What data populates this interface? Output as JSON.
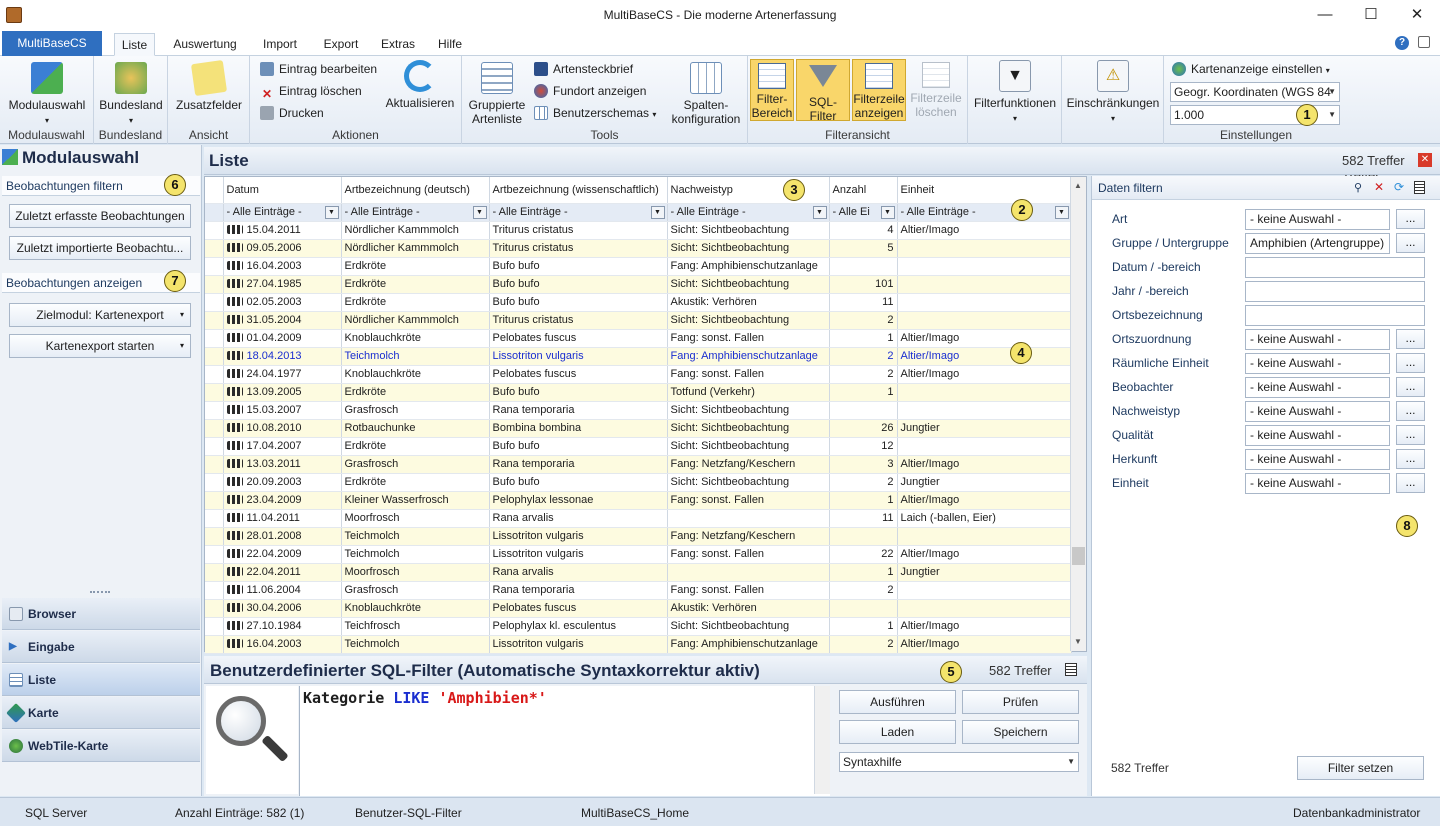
{
  "window": {
    "title": "MultiBaseCS - Die moderne Artenerfassung",
    "minimize": "—",
    "maximize": "☐",
    "close": "✕"
  },
  "ribbon_tabs": {
    "file": "MultiBaseCS",
    "tabs": [
      "Liste",
      "Auswertung",
      "Import",
      "Export",
      "Extras",
      "Hilfe"
    ],
    "help": "?"
  },
  "ribbon": {
    "modulauswahl": {
      "button": "Modulauswahl",
      "label": "Modulauswahl"
    },
    "bundesland": {
      "button": "Bundesland",
      "label": "Bundesland"
    },
    "ansicht": {
      "button": "Zusatzfelder",
      "label": "Ansicht"
    },
    "aktionen": {
      "edit": "Eintrag  bearbeiten",
      "delete": "Eintrag  löschen",
      "print": "Drucken",
      "refresh": "Aktualisieren",
      "label": "Aktionen"
    },
    "tools": {
      "grouped_line1": "Gruppierte",
      "grouped_line2": "Artenliste",
      "steckbrief": "Artensteckbrief",
      "fundort": "Fundort anzeigen",
      "schemas": "Benutzerschemas",
      "spalten_line1": "Spalten-",
      "spalten_line2": "konfiguration",
      "label": "Tools"
    },
    "filteransicht": {
      "bereich_line1": "Filter-",
      "bereich_line2": "Bereich",
      "sql": "SQL-Filter",
      "zeile_line1": "Filterzeile",
      "zeile_line2": "anzeigen",
      "loeschen_line1": "Filterzeile",
      "loeschen_line2": "löschen",
      "label": "Filteransicht"
    },
    "filterfunktionen": {
      "button": "Filterfunktionen"
    },
    "einschraenkungen": {
      "button": "Einschränkungen"
    },
    "einstellungen": {
      "karte": "Kartenanzeige  einstellen",
      "coords": "Geogr. Koordinaten (WGS 84",
      "scale": "1.000",
      "label": "Einstellungen"
    }
  },
  "callouts": [
    "1",
    "2",
    "3",
    "4",
    "5",
    "6",
    "7",
    "8"
  ],
  "left": {
    "title": "Modulauswahl",
    "section1": "Beobachtungen filtern",
    "btn1": "Zuletzt erfasste Beobachtungen",
    "btn2": "Zuletzt  importierte Beobachtu...",
    "section2": "Beobachtungen anzeigen",
    "btn3": "Zielmodul: Kartenexport",
    "btn4": "Kartenexport starten",
    "nav": [
      "Browser",
      "Eingabe",
      "Liste",
      "Karte",
      "WebTile-Karte"
    ]
  },
  "list": {
    "title": "Liste",
    "count": "582 Treffer",
    "columns": [
      "Datum",
      "Artbezeichnung (deutsch)",
      "Artbezeichnung (wissenschaftlich)",
      "Nachweistyp",
      "Anzahl",
      "Einheit"
    ],
    "filters": [
      "- Alle Einträge -",
      "- Alle Einträge -",
      "- Alle Einträge -",
      "- Alle Einträge -",
      "- Alle Ei",
      "- Alle Einträge -"
    ],
    "rows": [
      [
        "15.04.2011",
        "Nördlicher Kammmolch",
        "Triturus cristatus",
        "Sicht: Sichtbeobachtung",
        "4",
        "Altier/Imago"
      ],
      [
        "09.05.2006",
        "Nördlicher Kammmolch",
        "Triturus cristatus",
        "Sicht: Sichtbeobachtung",
        "5",
        ""
      ],
      [
        "16.04.2003",
        "Erdkröte",
        "Bufo bufo",
        "Fang: Amphibienschutzanlage",
        "",
        ""
      ],
      [
        "27.04.1985",
        "Erdkröte",
        "Bufo bufo",
        "Sicht: Sichtbeobachtung",
        "101",
        ""
      ],
      [
        "02.05.2003",
        "Erdkröte",
        "Bufo bufo",
        "Akustik: Verhören",
        "11",
        ""
      ],
      [
        "31.05.2004",
        "Nördlicher Kammmolch",
        "Triturus cristatus",
        "Sicht: Sichtbeobachtung",
        "2",
        ""
      ],
      [
        "01.04.2009",
        "Knoblauchkröte",
        "Pelobates fuscus",
        "Fang: sonst. Fallen",
        "1",
        "Altier/Imago"
      ],
      [
        "18.04.2013",
        "Teichmolch",
        "Lissotriton vulgaris",
        "Fang: Amphibienschutzanlage",
        "2",
        "Altier/Imago"
      ],
      [
        "24.04.1977",
        "Knoblauchkröte",
        "Pelobates fuscus",
        "Fang: sonst. Fallen",
        "2",
        "Altier/Imago"
      ],
      [
        "13.09.2005",
        "Erdkröte",
        "Bufo bufo",
        "Totfund (Verkehr)",
        "1",
        ""
      ],
      [
        "15.03.2007",
        "Grasfrosch",
        "Rana temporaria",
        "Sicht: Sichtbeobachtung",
        "",
        ""
      ],
      [
        "10.08.2010",
        "Rotbauchunke",
        "Bombina bombina",
        "Sicht: Sichtbeobachtung",
        "26",
        "Jungtier"
      ],
      [
        "17.04.2007",
        "Erdkröte",
        "Bufo bufo",
        "Sicht: Sichtbeobachtung",
        "12",
        ""
      ],
      [
        "13.03.2011",
        "Grasfrosch",
        "Rana temporaria",
        "Fang: Netzfang/Keschern",
        "3",
        "Altier/Imago"
      ],
      [
        "20.09.2003",
        "Erdkröte",
        "Bufo bufo",
        "Sicht: Sichtbeobachtung",
        "2",
        "Jungtier"
      ],
      [
        "23.04.2009",
        "Kleiner Wasserfrosch",
        "Pelophylax lessonae",
        "Fang: sonst. Fallen",
        "1",
        "Altier/Imago"
      ],
      [
        "11.04.2011",
        "Moorfrosch",
        "Rana arvalis",
        "",
        "11",
        "Laich (-ballen, Eier)"
      ],
      [
        "28.01.2008",
        "Teichmolch",
        "Lissotriton vulgaris",
        "Fang: Netzfang/Keschern",
        "",
        ""
      ],
      [
        "22.04.2009",
        "Teichmolch",
        "Lissotriton vulgaris",
        "Fang: sonst. Fallen",
        "22",
        "Altier/Imago"
      ],
      [
        "22.04.2011",
        "Moorfrosch",
        "Rana arvalis",
        "",
        "1",
        "Jungtier"
      ],
      [
        "11.06.2004",
        "Grasfrosch",
        "Rana temporaria",
        "Fang: sonst. Fallen",
        "2",
        ""
      ],
      [
        "30.04.2006",
        "Knoblauchkröte",
        "Pelobates fuscus",
        "Akustik: Verhören",
        "",
        ""
      ],
      [
        "27.10.1984",
        "Teichfrosch",
        "Pelophylax kl. esculentus",
        "Sicht: Sichtbeobachtung",
        "1",
        "Altier/Imago"
      ],
      [
        "16.04.2003",
        "Teichmolch",
        "Lissotriton vulgaris",
        "Fang: Amphibienschutzanlage",
        "2",
        "Altier/Imago"
      ]
    ]
  },
  "sql": {
    "title": "Benutzerdefinierter SQL-Filter (Automatische Syntaxkorrektur aktiv)",
    "count": "582 Treffer",
    "code_field": "Kategorie",
    "code_kw": "LIKE",
    "code_str": "'Amphibien*'",
    "btn_run": "Ausführen",
    "btn_check": "Prüfen",
    "btn_load": "Laden",
    "btn_save": "Speichern",
    "syntax": "Syntaxhilfe"
  },
  "right": {
    "title": "Daten filtern",
    "fields": [
      {
        "label": "Art",
        "value": "- keine Auswahl -"
      },
      {
        "label": "Gruppe / Untergruppe",
        "value": "Amphibien (Artengruppe)"
      },
      {
        "label": "Datum / -bereich",
        "value": ""
      },
      {
        "label": "Jahr / -bereich",
        "value": ""
      },
      {
        "label": "Ortsbezeichnung",
        "value": ""
      },
      {
        "label": "Ortszuordnung",
        "value": "- keine Auswahl -"
      },
      {
        "label": "Räumliche Einheit",
        "value": "- keine Auswahl -"
      },
      {
        "label": "Beobachter",
        "value": "- keine Auswahl -"
      },
      {
        "label": "Nachweistyp",
        "value": "- keine Auswahl -"
      },
      {
        "label": "Qualität",
        "value": "- keine Auswahl -"
      },
      {
        "label": "Herkunft",
        "value": "- keine Auswahl -"
      },
      {
        "label": "Einheit",
        "value": "- keine Auswahl -"
      }
    ],
    "dots": "...",
    "count": "582 Treffer",
    "apply": "Filter setzen"
  },
  "status": {
    "server": "SQL Server",
    "entries": "Anzahl Einträge: 582 (1)",
    "filter": "Benutzer-SQL-Filter",
    "db": "MultiBaseCS_Home",
    "user": "Datenbankadministrator"
  },
  "colors": {
    "accent": "#2f6fc0",
    "highlight": "#f9d66a",
    "row_alt": "#fdfbe0"
  }
}
